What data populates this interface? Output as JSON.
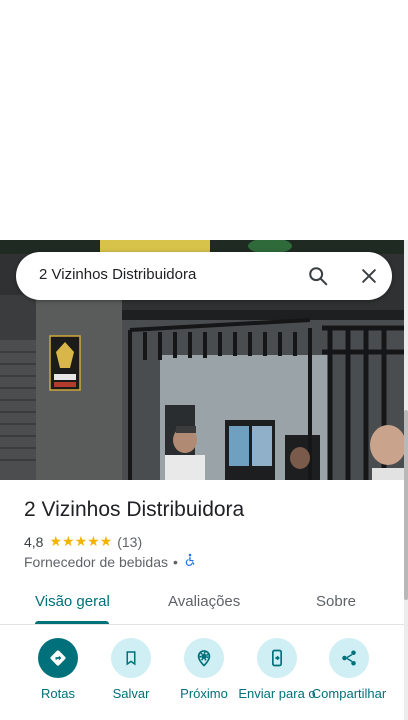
{
  "search": {
    "query": "2 Vizinhos Distribuidora",
    "search_icon": "search-icon",
    "close_icon": "close-icon"
  },
  "place": {
    "name": "2 Vizinhos Distribuidora",
    "rating": "4,8",
    "stars": "★★★★★",
    "review_count": "(13)",
    "category": "Fornecedor de bebidas",
    "separator": "•",
    "accessibility_icon": "wheelchair-icon"
  },
  "tabs": [
    {
      "label": "Visão geral",
      "active": true
    },
    {
      "label": "Avaliações",
      "active": false
    },
    {
      "label": "Sobre",
      "active": false
    }
  ],
  "actions": [
    {
      "label": "Rotas",
      "icon": "directions-icon"
    },
    {
      "label": "Salvar",
      "icon": "bookmark-icon"
    },
    {
      "label": "Próximo",
      "icon": "nearby-icon"
    },
    {
      "label": "Enviar para o",
      "icon": "send-to-phone-icon"
    },
    {
      "label": "Compartilhar",
      "icon": "share-icon"
    }
  ],
  "colors": {
    "accent": "#00707a",
    "action_bg": "#cfeff4",
    "star": "#f2b400"
  }
}
